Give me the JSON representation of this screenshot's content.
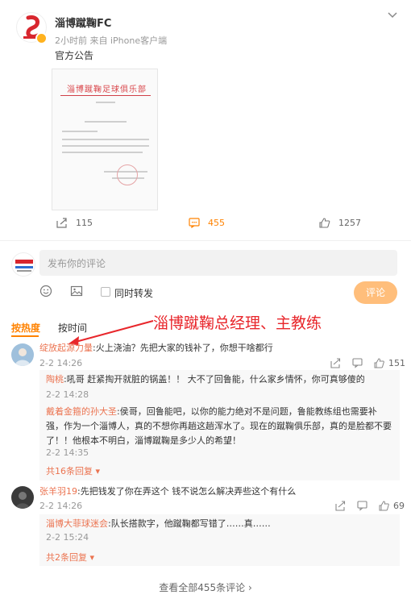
{
  "post": {
    "author": "淄博蹴鞠FC",
    "meta": "2小时前  来自 iPhone客户端",
    "text": "官方公告",
    "doc_title": "淄博蹴鞠足球俱乐部",
    "actions": {
      "repost_count": "115",
      "comment_count": "455",
      "like_count": "1257"
    }
  },
  "composer": {
    "placeholder": "发布你的评论",
    "repost_label": "同时转发",
    "submit_label": "评论"
  },
  "tabs": {
    "hot": "按热度",
    "time": "按时间"
  },
  "annotation": "淄博蹴鞠总经理、主教练",
  "comments": [
    {
      "name": "绽放起源力量",
      "text": ":火上浇油？先把大家的钱补了，你想干啥都行",
      "time": "2-2 14:26",
      "likes": "151",
      "replies": [
        {
          "name": "陶桃",
          "text": ":吼哥 赶紧掏开就脏的锅盖！！ 大不了回鲁能，什么家乡情怀，你可真够傻的",
          "time": "2-2 14:28"
        },
        {
          "name": "戴着金箍的孙大圣",
          "text": ":侯哥，回鲁能吧，以你的能力绝对不是问题，鲁能教练组也需要补强，作为一个淄博人，真的不想你再趟这趟浑水了。现在的蹴鞠俱乐部，真的是脸都不要了！！他根本不明白，淄博蹴鞠是多少人的希望！",
          "time": "2-2 14:35"
        }
      ],
      "more": "共16条回复"
    },
    {
      "name": "张羊羽19",
      "text": ":先把钱发了你在弄这个 钱不说怎么解决弄些这个有什么",
      "time": "2-2 14:26",
      "likes": "69",
      "replies": [
        {
          "name": "淄博大菲球迷会",
          "text": ":队长搭款字，他蹴鞠都写错了……真……",
          "time": "2-2 15:24"
        }
      ],
      "more": "共2条回复"
    }
  ],
  "footer": "查看全部455条评论 ›",
  "colors": {
    "accent": "#ff8200",
    "name": "#eb7350",
    "annotation": "#e8262b"
  }
}
